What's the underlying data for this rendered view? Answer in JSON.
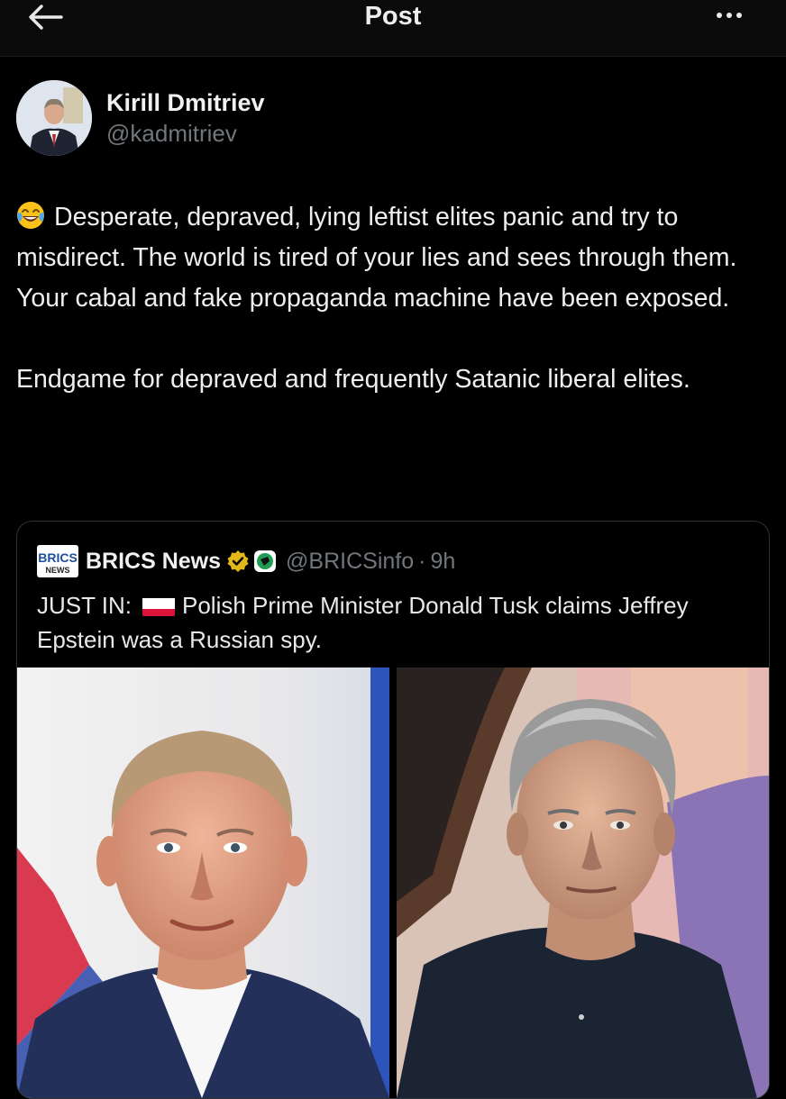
{
  "header": {
    "title": "Post",
    "back_icon": "arrow-left-icon",
    "more_icon": "more-horizontal-icon"
  },
  "author": {
    "name": "Kirill Dmitriev",
    "handle": "@kadmitriev"
  },
  "tweet": {
    "emoji": "face-with-tears-of-joy",
    "paragraph1": "Desperate, depraved, lying leftist elites panic and try to misdirect. The world is tired of your lies and sees through them. Your cabal and fake propaganda machine have been exposed.",
    "paragraph2": "Endgame for depraved and frequently Satanic liberal elites."
  },
  "quote": {
    "logo_icon": "brics-news-logo",
    "name": "BRICS News",
    "verified_icon": "gold-verified-badge-icon",
    "affiliation_icon": "affiliate-badge-icon",
    "handle": "@BRICSinfo",
    "separator": "·",
    "time": "9h",
    "text_prefix": "JUST IN:",
    "flag_icon": "poland-flag-icon",
    "text": "Polish Prime Minister Donald Tusk claims Jeffrey Epstein was a Russian spy.",
    "images": [
      "photo-donald-tusk",
      "photo-jeffrey-epstein"
    ]
  },
  "colors": {
    "background": "#000000",
    "text": "#e7e9ea",
    "secondary_text": "#71767b",
    "border": "#2f3336",
    "verified_gold": "#e2b719"
  }
}
